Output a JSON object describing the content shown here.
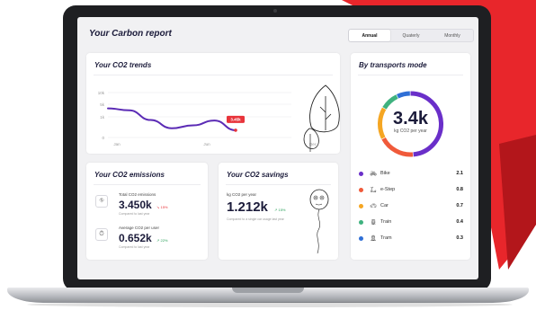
{
  "header": {
    "title": "Your Carbon report",
    "periods": [
      "Annual",
      "Quaterly",
      "Monthly"
    ],
    "active_period": "Annual"
  },
  "trends": {
    "title": "Your CO2 trends",
    "tooltip": "3.45k"
  },
  "emissions": {
    "title": "Your CO2 emissions",
    "total_label": "Total CO2 emissions",
    "total_value": "3.450k",
    "total_delta": "↘ 15%",
    "total_note": "Compared to last year",
    "avg_label": "Average CO2 per user",
    "avg_value": "0.652k",
    "avg_delta": "↗ 22%",
    "avg_note": "Compared to last year"
  },
  "savings": {
    "title": "Your CO2 savings",
    "label": "kg CO2 per year",
    "value": "1.212k",
    "delta": "↗ 15%",
    "note": "Compared to a single car usage last year"
  },
  "transports": {
    "title": "By transports mode",
    "total_value": "3.4k",
    "total_unit": "kg CO2 per year",
    "modes": [
      {
        "name": "Bike",
        "value": "2.1",
        "color": "#6a2fc9",
        "icon": "bike-icon"
      },
      {
        "name": "e-Step",
        "value": "0.8",
        "color": "#f05a3a",
        "icon": "scooter-icon"
      },
      {
        "name": "Car",
        "value": "0.7",
        "color": "#f5a623",
        "icon": "car-icon"
      },
      {
        "name": "Train",
        "value": "0.4",
        "color": "#3fb27f",
        "icon": "train-icon"
      },
      {
        "name": "Tram",
        "value": "0.3",
        "color": "#2f6fd6",
        "icon": "tram-icon"
      }
    ]
  },
  "chart_data": {
    "type": "line",
    "title": "Your CO2 trends",
    "x": [
      "Jan",
      "Jun",
      "Dec"
    ],
    "y_ticks": [
      "10k",
      "5k",
      "1k",
      "0"
    ],
    "series": [
      {
        "color": "#5b2bb5",
        "x": [
          0,
          1.5,
          3,
          4.5,
          6,
          7.5,
          9
        ],
        "values": [
          6.0,
          5.6,
          3.6,
          1.9,
          2.5,
          3.5,
          1.5
        ]
      }
    ],
    "annotation": "3.45k",
    "grid": true
  }
}
